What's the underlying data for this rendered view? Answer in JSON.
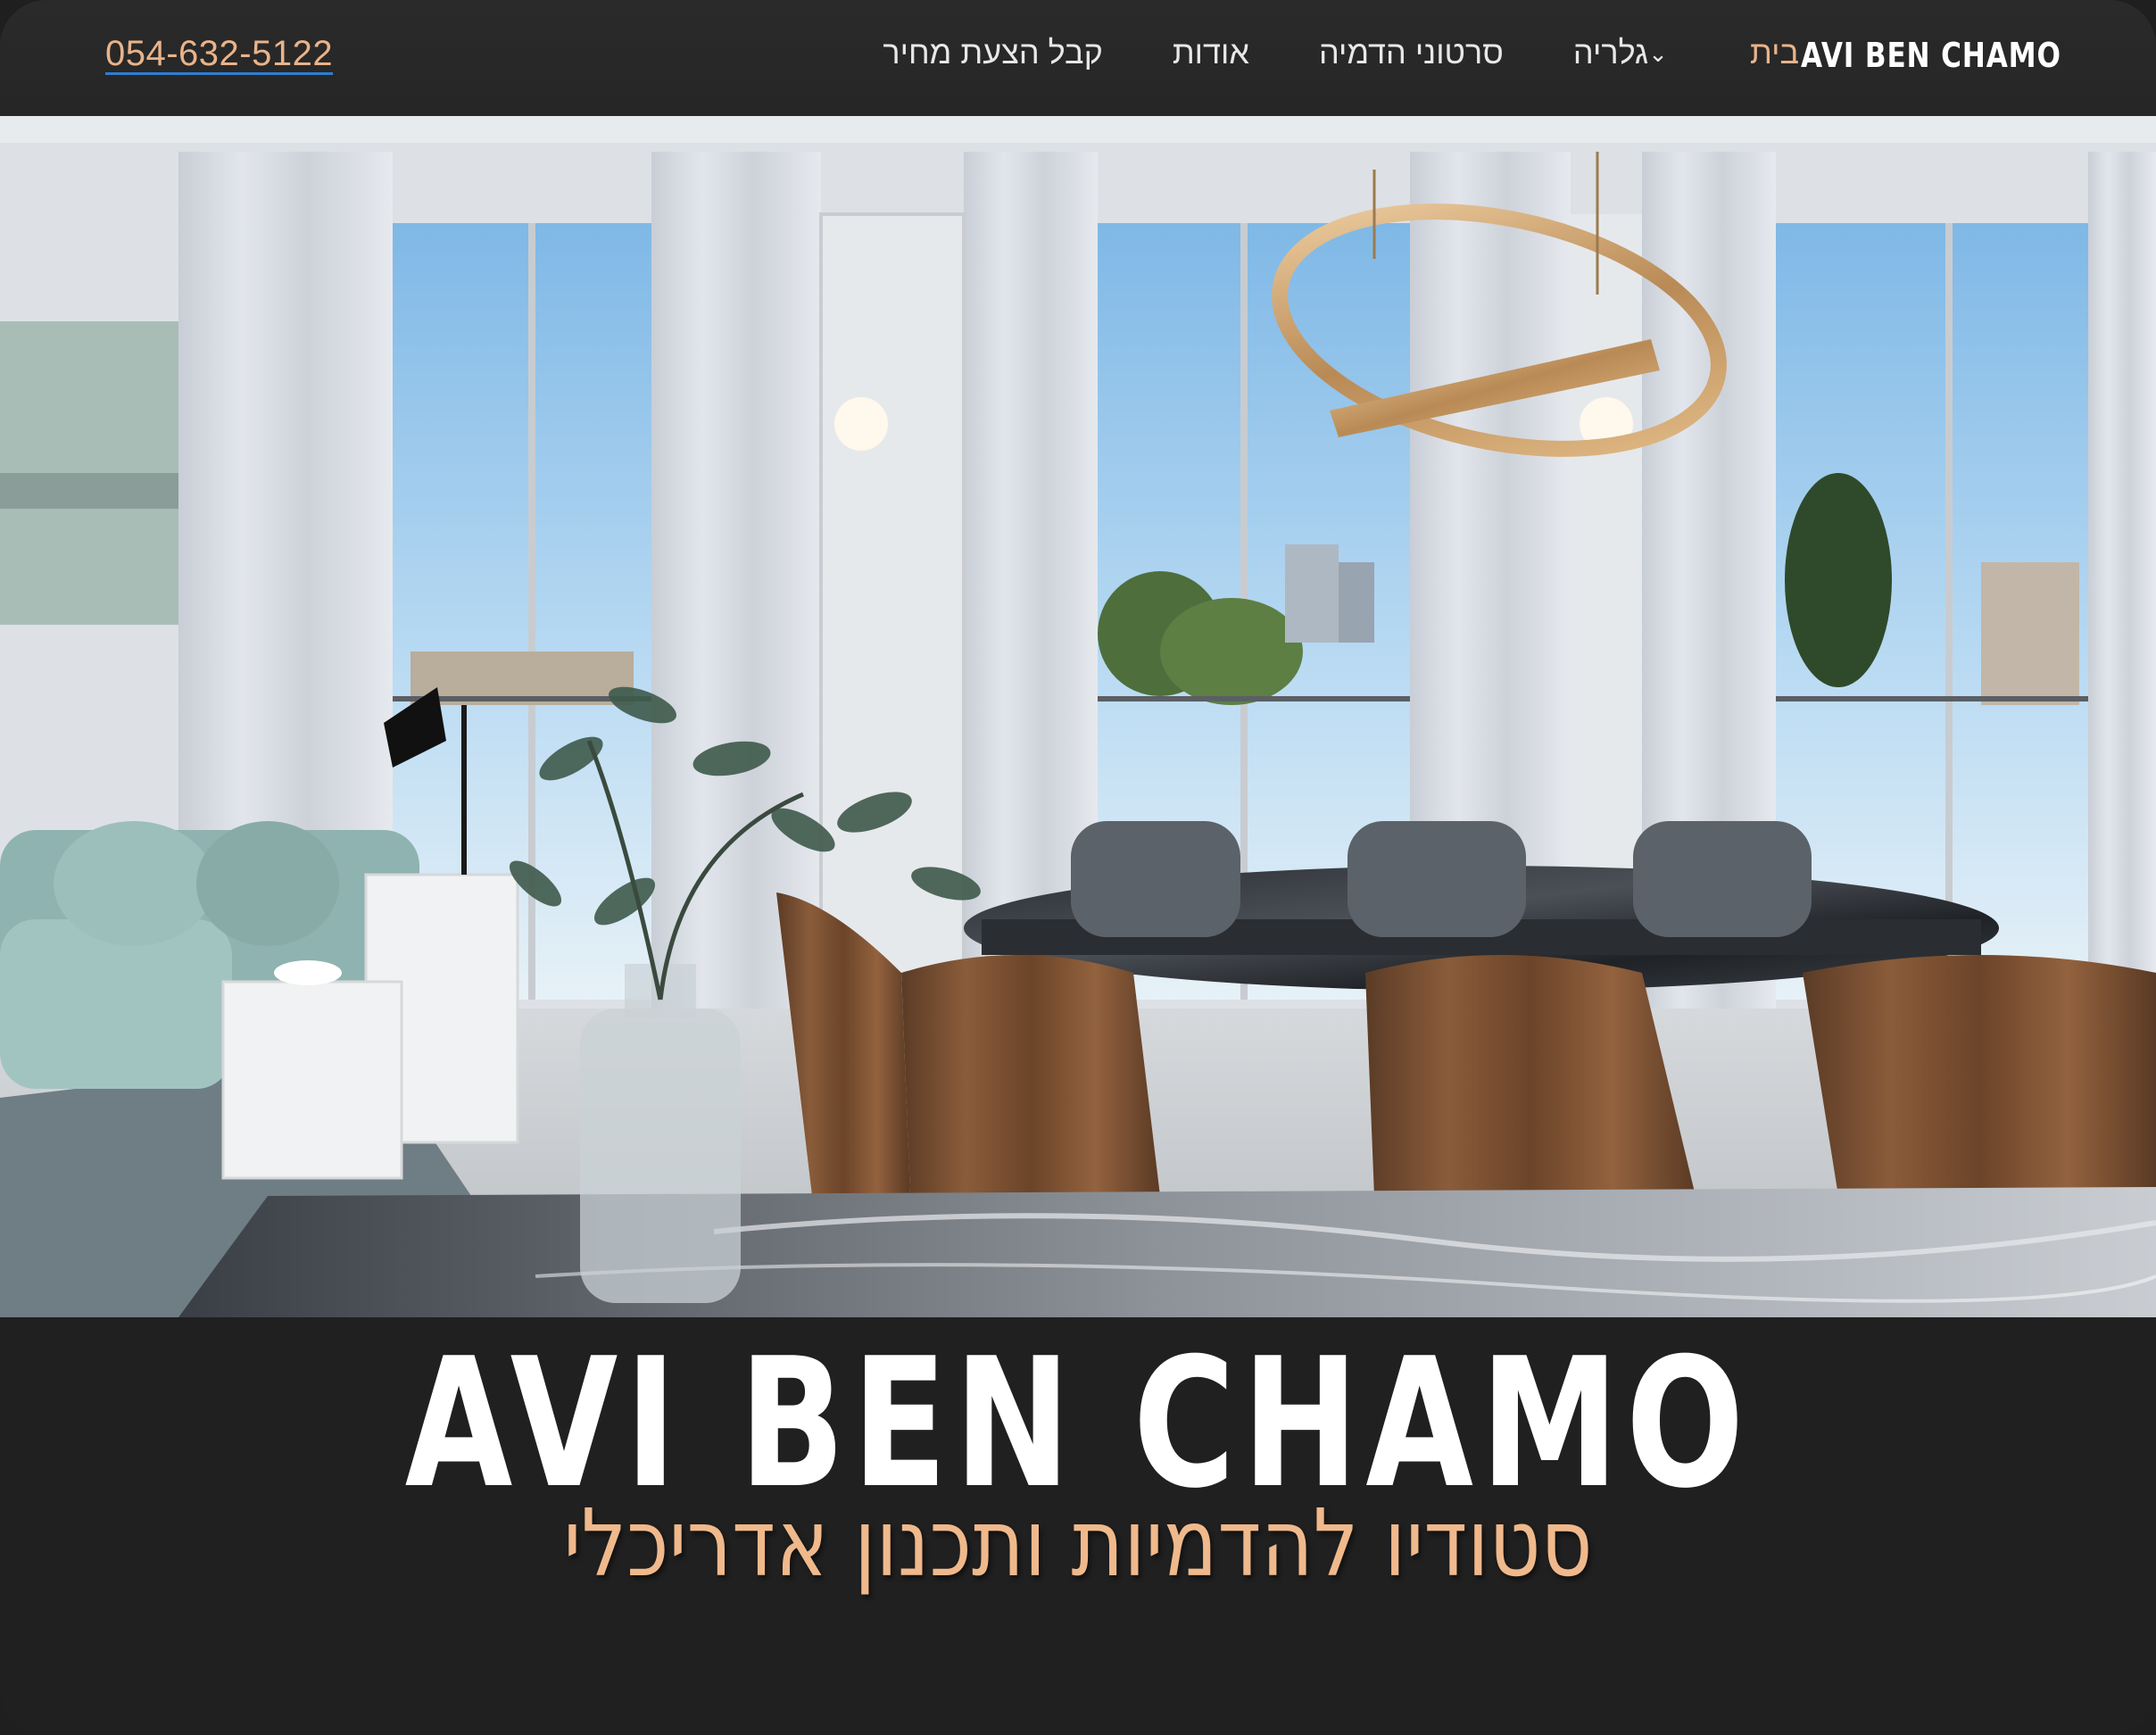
{
  "nav": {
    "logo": "AVI BEN CHAMO",
    "phone": "054-632-5122",
    "items": [
      {
        "label": "בית",
        "active": true
      },
      {
        "label": "גלריה",
        "dropdown": true
      },
      {
        "label": "סרטוני הדמיה"
      },
      {
        "label": "אודות"
      },
      {
        "label": "קבל הצעת מחיר"
      }
    ],
    "dropdown_icon": "chevron-down-icon"
  },
  "hero": {
    "image": "architectural interior rendering"
  },
  "brand": {
    "title": "AVI BEN CHAMO",
    "subtitle": "סטודיו להדמיות ותכנון אדריכלי"
  },
  "colors": {
    "accent": "#e9b38a",
    "background": "#202020",
    "nav": "#262626"
  }
}
